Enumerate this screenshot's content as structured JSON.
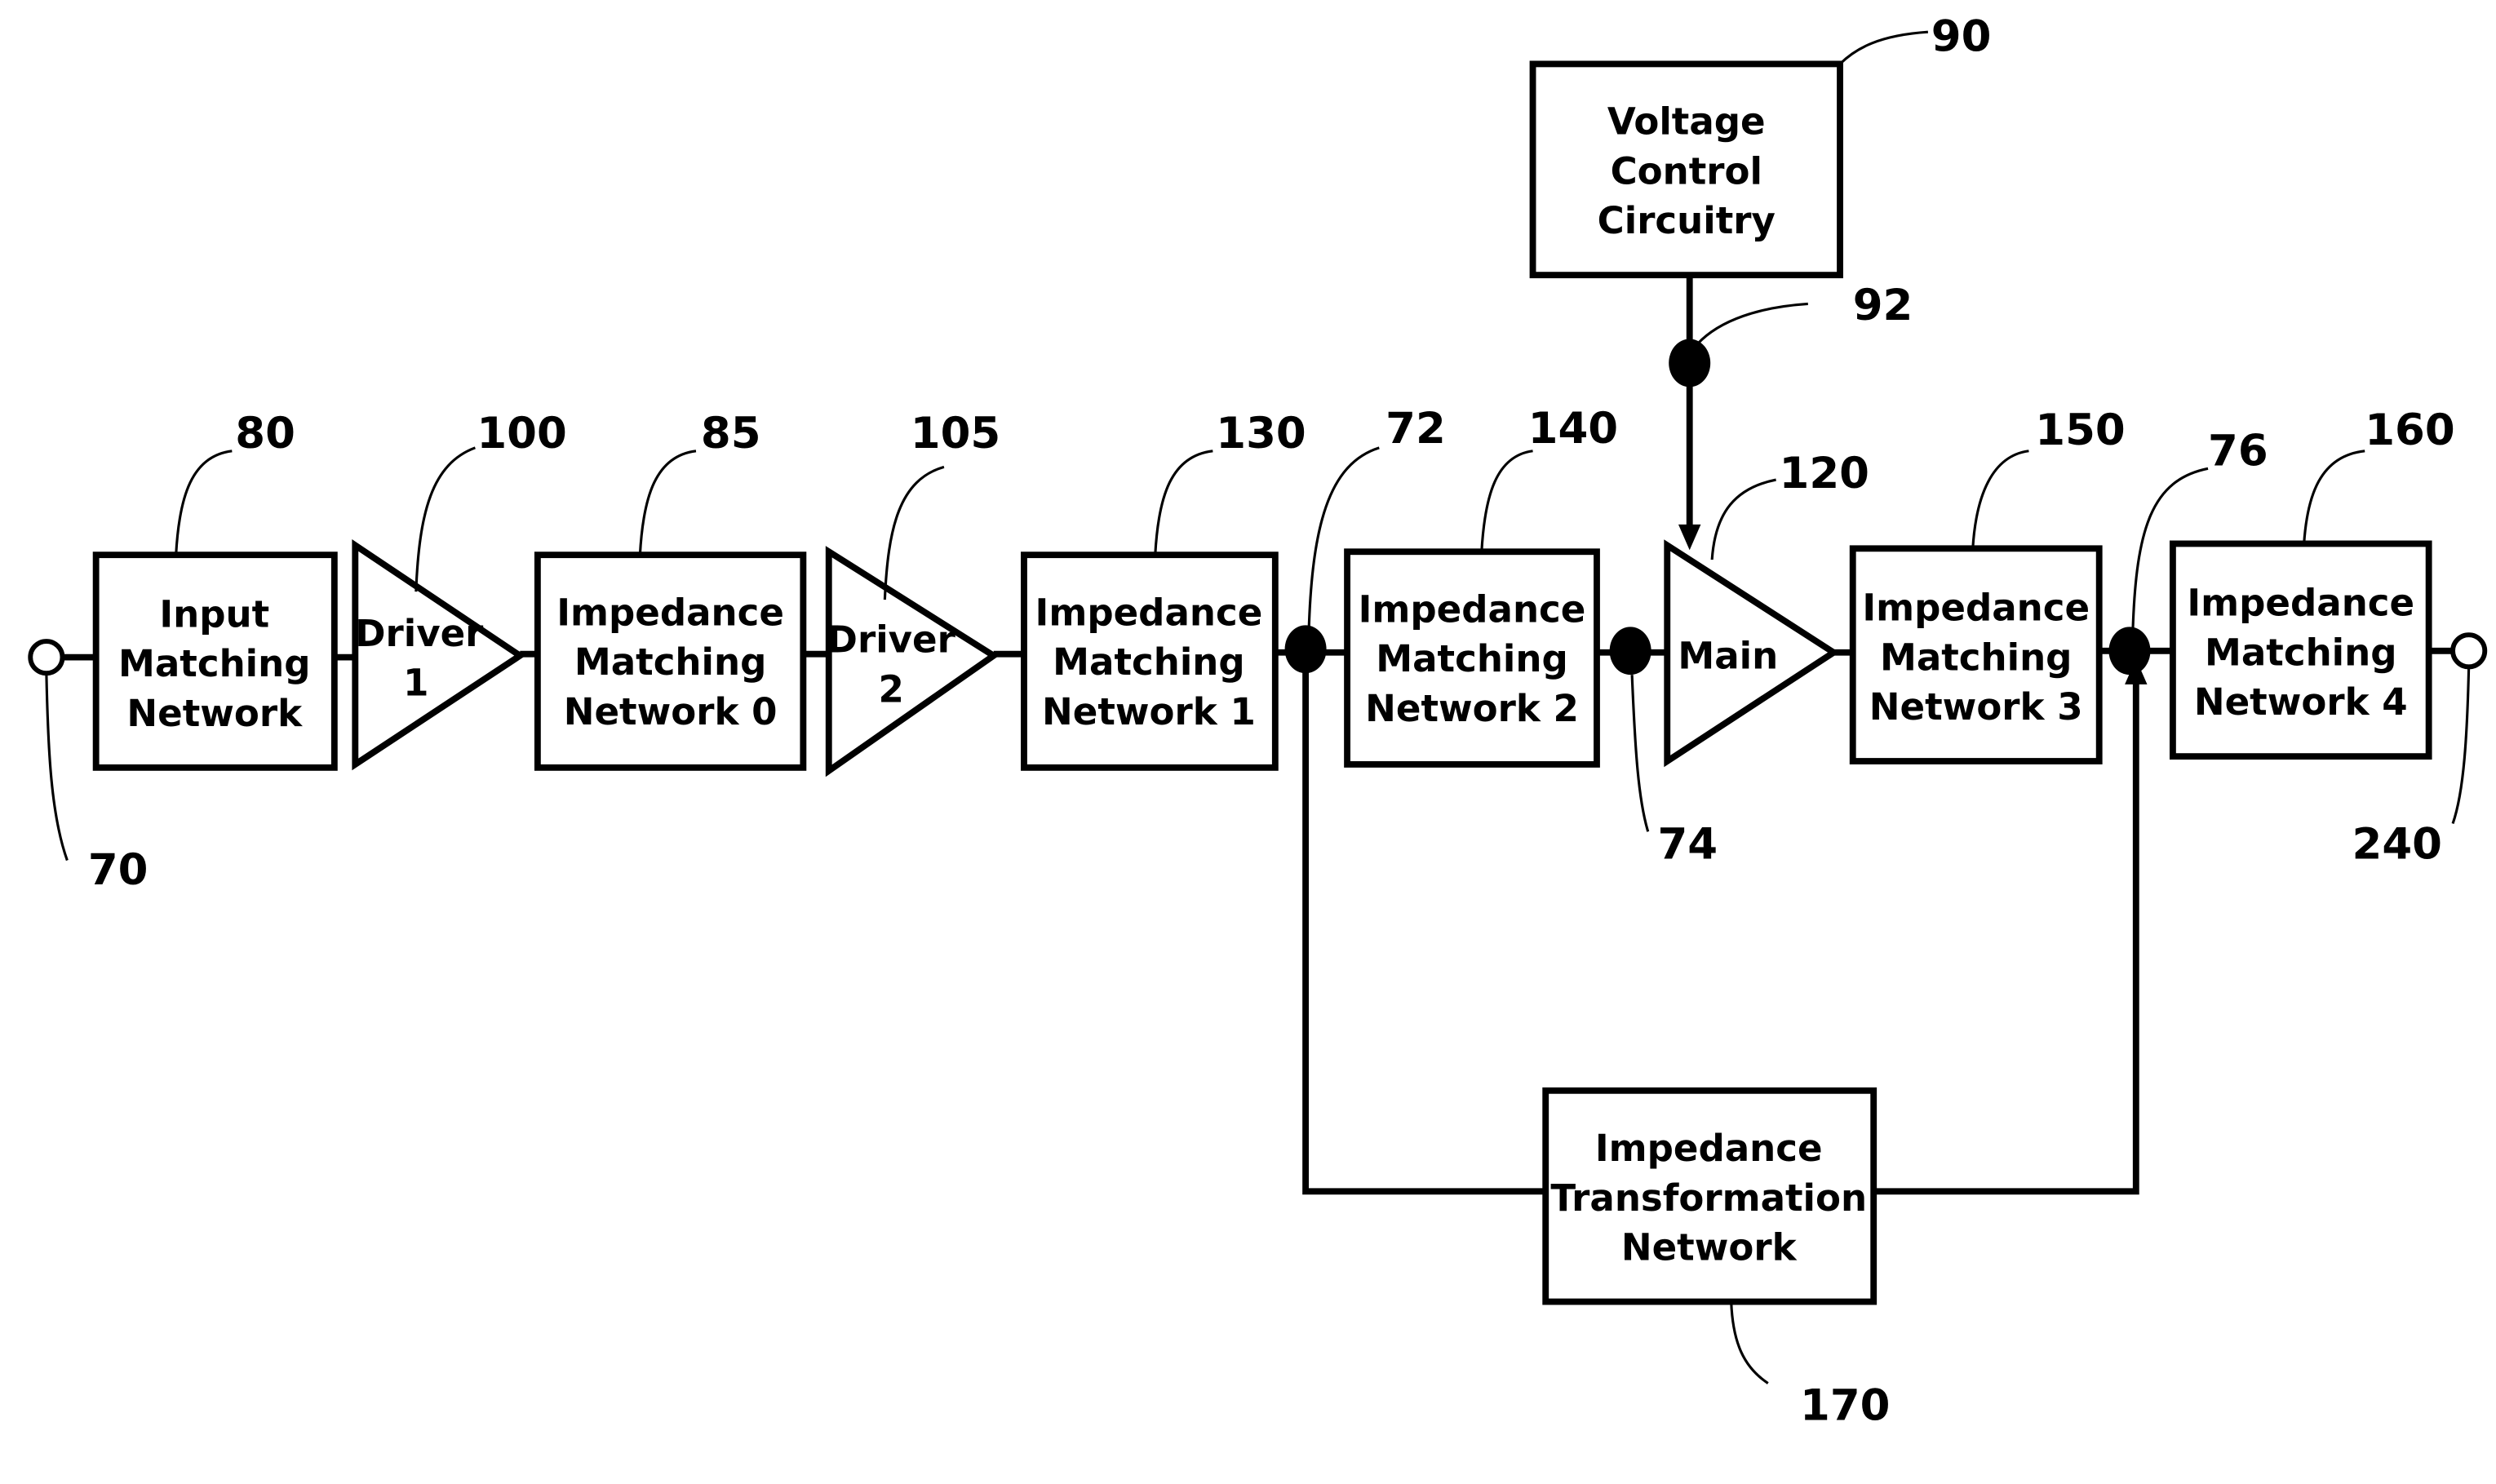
{
  "diagram": {
    "type": "block-diagram",
    "blocks": {
      "input_matching": {
        "lines": [
          "Input",
          "Matching",
          "Network"
        ],
        "ref": "80"
      },
      "driver1": {
        "lines": [
          "Driver",
          "1"
        ],
        "ref": "100"
      },
      "imn0": {
        "lines": [
          "Impedance",
          "Matching",
          "Network 0"
        ],
        "ref": "85"
      },
      "driver2": {
        "lines": [
          "Driver",
          "2"
        ],
        "ref": "105"
      },
      "imn1": {
        "lines": [
          "Impedance",
          "Matching",
          "Network 1"
        ],
        "ref": "130"
      },
      "imn2": {
        "lines": [
          "Impedance",
          "Matching",
          "Network 2"
        ],
        "ref": "140"
      },
      "main": {
        "lines": [
          "Main"
        ],
        "ref": "120"
      },
      "imn3": {
        "lines": [
          "Impedance",
          "Matching",
          "Network 3"
        ],
        "ref": "150"
      },
      "imn4": {
        "lines": [
          "Impedance",
          "Matching",
          "Network 4"
        ],
        "ref": "160"
      },
      "vcc": {
        "lines": [
          "Voltage",
          "Control",
          "Circuitry"
        ],
        "ref": "90"
      },
      "itn": {
        "lines": [
          "Impedance",
          "Transformation",
          "Network"
        ],
        "ref": "170"
      }
    },
    "nodes": {
      "input_terminal": "70",
      "output_terminal": "240",
      "node72": "72",
      "node74": "74",
      "node76": "76",
      "node92": "92"
    }
  }
}
